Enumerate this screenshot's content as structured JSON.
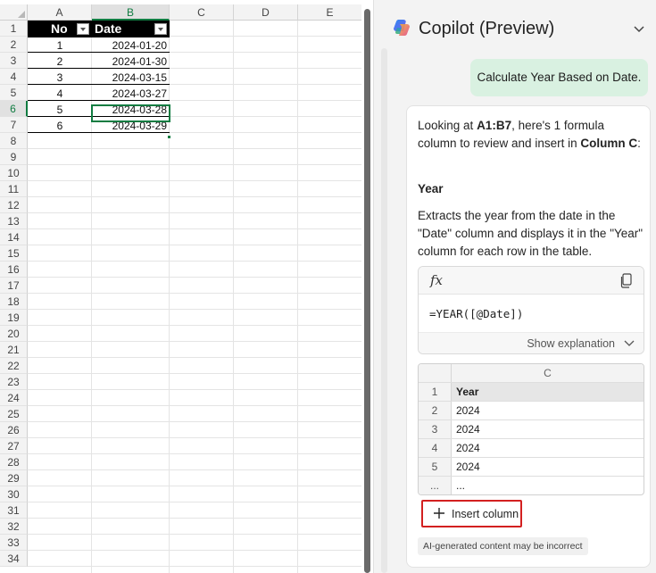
{
  "sheet": {
    "columns": [
      "A",
      "B",
      "C",
      "D",
      "E"
    ],
    "rows": [
      "1",
      "2",
      "3",
      "4",
      "5",
      "6",
      "7",
      "8",
      "9",
      "10",
      "11",
      "12",
      "13",
      "14",
      "15",
      "16",
      "17",
      "18",
      "19",
      "20",
      "21",
      "22",
      "23",
      "24",
      "25",
      "26",
      "27",
      "28",
      "29",
      "30",
      "31",
      "32",
      "33",
      "34"
    ],
    "table_headers": [
      "No",
      "Date"
    ],
    "data": [
      {
        "no": "1",
        "date": "2024-01-20"
      },
      {
        "no": "2",
        "date": "2024-01-30"
      },
      {
        "no": "3",
        "date": "2024-03-15"
      },
      {
        "no": "4",
        "date": "2024-03-27"
      },
      {
        "no": "5",
        "date": "2024-03-28"
      },
      {
        "no": "6",
        "date": "2024-03-29"
      }
    ]
  },
  "copilot": {
    "title": "Copilot (Preview)",
    "user_message": "Calculate Year Based on Date.",
    "intro_pre": "Looking at ",
    "intro_range": "A1:B7",
    "intro_mid": ", here's 1 formula column to review and insert in ",
    "intro_target": "Column C",
    "intro_end": ":",
    "suggestion_title": "Year",
    "suggestion_desc": "Extracts the year from the date in the \"Date\" column and displays it in the \"Year\" column for each row in the table.",
    "fx_label": "fx",
    "formula": "=YEAR([@Date])",
    "show_explanation": "Show explanation",
    "preview": {
      "column_letter": "C",
      "rows": [
        {
          "num": "1",
          "val": "Year"
        },
        {
          "num": "2",
          "val": "2024"
        },
        {
          "num": "3",
          "val": "2024"
        },
        {
          "num": "4",
          "val": "2024"
        },
        {
          "num": "5",
          "val": "2024"
        },
        {
          "num": "...",
          "val": "..."
        }
      ]
    },
    "insert_label": "Insert column",
    "disclaimer": "AI-generated content may be incorrect"
  },
  "colors": {
    "accent_green": "#107c41",
    "user_bubble": "#d9f1e1",
    "highlight_red": "#d32020"
  }
}
